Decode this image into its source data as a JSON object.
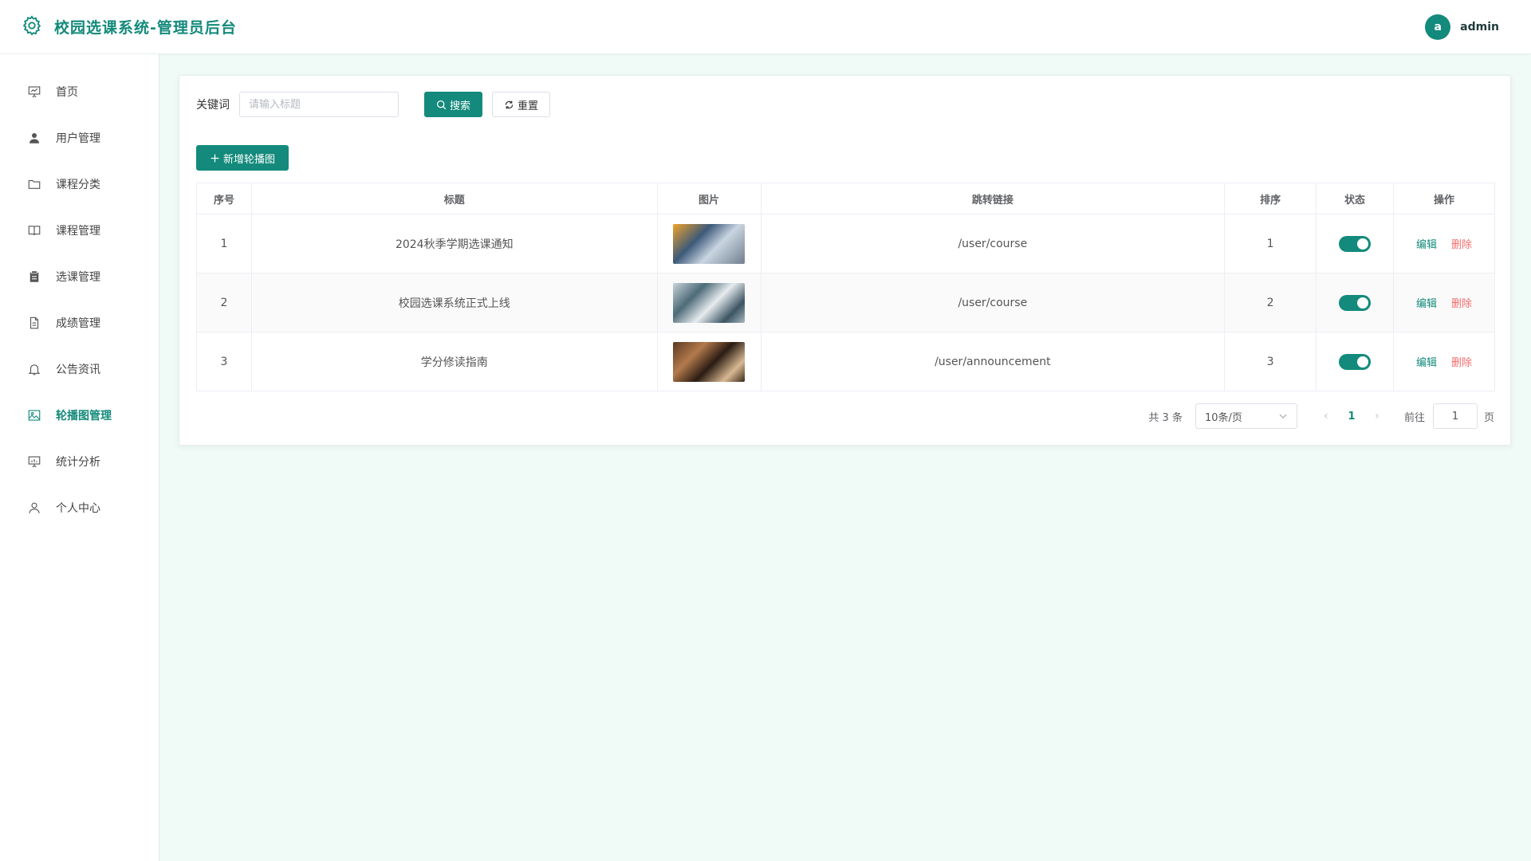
{
  "header": {
    "title": "校园选课系统-管理员后台",
    "avatar_letter": "a",
    "username": "admin"
  },
  "sidebar": {
    "items": [
      {
        "label": "首页",
        "icon": "presentation-icon",
        "active": false
      },
      {
        "label": "用户管理",
        "icon": "user-icon",
        "active": false
      },
      {
        "label": "课程分类",
        "icon": "folder-icon",
        "active": false
      },
      {
        "label": "课程管理",
        "icon": "book-icon",
        "active": false
      },
      {
        "label": "选课管理",
        "icon": "clipboard-icon",
        "active": false
      },
      {
        "label": "成绩管理",
        "icon": "document-icon",
        "active": false
      },
      {
        "label": "公告资讯",
        "icon": "bell-icon",
        "active": false
      },
      {
        "label": "轮播图管理",
        "icon": "picture-icon",
        "active": true
      },
      {
        "label": "统计分析",
        "icon": "chart-board-icon",
        "active": false
      },
      {
        "label": "个人中心",
        "icon": "user-outline-icon",
        "active": false
      }
    ]
  },
  "search": {
    "label": "关键词",
    "placeholder": "请输入标题",
    "search_button": "搜索",
    "reset_button": "重置"
  },
  "actions": {
    "add_button": "新增轮播图"
  },
  "table": {
    "headers": [
      "序号",
      "标题",
      "图片",
      "跳转链接",
      "排序",
      "状态",
      "操作"
    ],
    "rows": [
      {
        "index": "1",
        "title": "2024秋季学期选课通知",
        "link": "/user/course",
        "sort": "1",
        "status_on": true
      },
      {
        "index": "2",
        "title": "校园选课系统正式上线",
        "link": "/user/course",
        "sort": "2",
        "status_on": true
      },
      {
        "index": "3",
        "title": "学分修读指南",
        "link": "/user/announcement",
        "sort": "3",
        "status_on": true
      }
    ],
    "edit_label": "编辑",
    "delete_label": "删除"
  },
  "pagination": {
    "total_text": "共 3 条",
    "page_size": "10条/页",
    "current_page": "1",
    "goto_label": "前往",
    "goto_value": "1",
    "goto_unit": "页"
  },
  "colors": {
    "primary": "#138a7b",
    "danger": "#f56c6c",
    "background": "#f0fbf8"
  }
}
